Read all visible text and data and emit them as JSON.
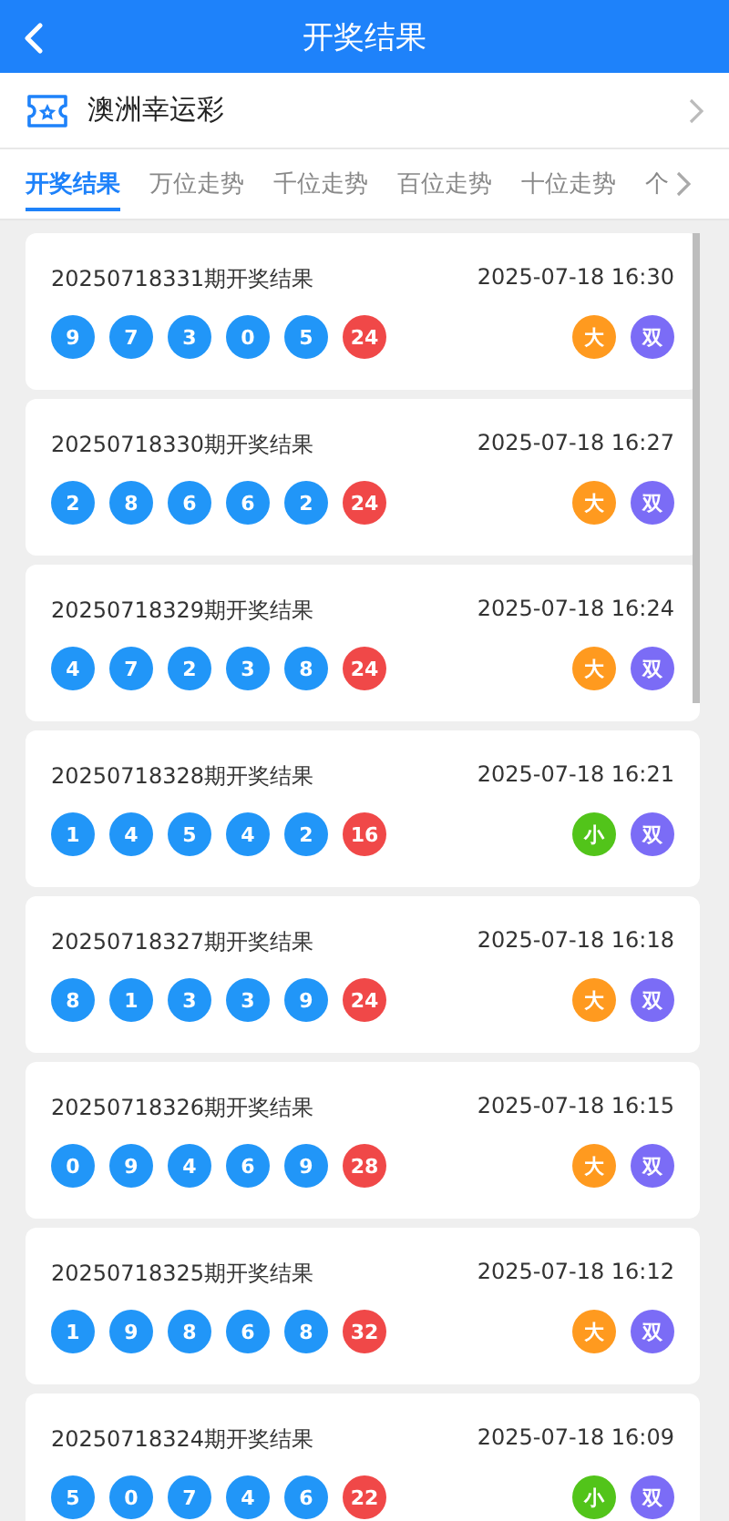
{
  "header": {
    "title": "开奖结果"
  },
  "lottery": {
    "name": "澳洲幸运彩"
  },
  "tabs": [
    {
      "label": "开奖结果",
      "selected": true
    },
    {
      "label": "万位走势",
      "selected": false
    },
    {
      "label": "千位走势",
      "selected": false
    },
    {
      "label": "百位走势",
      "selected": false
    },
    {
      "label": "十位走势",
      "selected": false
    },
    {
      "label": "个",
      "selected": false
    }
  ],
  "draws": [
    {
      "issue": "20250718331期开奖结果",
      "time": "2025-07-18 16:30",
      "balls": [
        "9",
        "7",
        "3",
        "0",
        "5"
      ],
      "sum": "24",
      "tags": [
        {
          "text": "大",
          "color": "#ff9a1f"
        },
        {
          "text": "双",
          "color": "#7b6cf6"
        }
      ]
    },
    {
      "issue": "20250718330期开奖结果",
      "time": "2025-07-18 16:27",
      "balls": [
        "2",
        "8",
        "6",
        "6",
        "2"
      ],
      "sum": "24",
      "tags": [
        {
          "text": "大",
          "color": "#ff9a1f"
        },
        {
          "text": "双",
          "color": "#7b6cf6"
        }
      ]
    },
    {
      "issue": "20250718329期开奖结果",
      "time": "2025-07-18 16:24",
      "balls": [
        "4",
        "7",
        "2",
        "3",
        "8"
      ],
      "sum": "24",
      "tags": [
        {
          "text": "大",
          "color": "#ff9a1f"
        },
        {
          "text": "双",
          "color": "#7b6cf6"
        }
      ]
    },
    {
      "issue": "20250718328期开奖结果",
      "time": "2025-07-18 16:21",
      "balls": [
        "1",
        "4",
        "5",
        "4",
        "2"
      ],
      "sum": "16",
      "tags": [
        {
          "text": "小",
          "color": "#52c41a"
        },
        {
          "text": "双",
          "color": "#7b6cf6"
        }
      ]
    },
    {
      "issue": "20250718327期开奖结果",
      "time": "2025-07-18 16:18",
      "balls": [
        "8",
        "1",
        "3",
        "3",
        "9"
      ],
      "sum": "24",
      "tags": [
        {
          "text": "大",
          "color": "#ff9a1f"
        },
        {
          "text": "双",
          "color": "#7b6cf6"
        }
      ]
    },
    {
      "issue": "20250718326期开奖结果",
      "time": "2025-07-18 16:15",
      "balls": [
        "0",
        "9",
        "4",
        "6",
        "9"
      ],
      "sum": "28",
      "tags": [
        {
          "text": "大",
          "color": "#ff9a1f"
        },
        {
          "text": "双",
          "color": "#7b6cf6"
        }
      ]
    },
    {
      "issue": "20250718325期开奖结果",
      "time": "2025-07-18 16:12",
      "balls": [
        "1",
        "9",
        "8",
        "6",
        "8"
      ],
      "sum": "32",
      "tags": [
        {
          "text": "大",
          "color": "#ff9a1f"
        },
        {
          "text": "双",
          "color": "#7b6cf6"
        }
      ]
    },
    {
      "issue": "20250718324期开奖结果",
      "time": "2025-07-18 16:09",
      "balls": [
        "5",
        "0",
        "7",
        "4",
        "6"
      ],
      "sum": "22",
      "tags": [
        {
          "text": "小",
          "color": "#52c41a"
        },
        {
          "text": "双",
          "color": "#7b6cf6"
        }
      ]
    }
  ]
}
